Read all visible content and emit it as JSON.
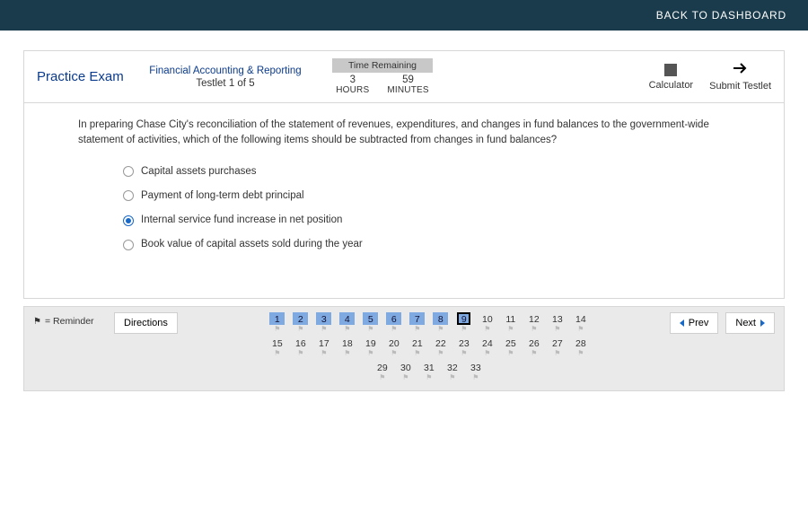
{
  "topbar": {
    "back_label": "BACK TO DASHBOARD"
  },
  "header": {
    "exam_title": "Practice Exam",
    "section_name": "Financial Accounting & Reporting",
    "testlet_text": "Testlet 1 of 5",
    "time_remaining_label": "Time Remaining",
    "hours_val": "3",
    "hours_label": "HOURS",
    "minutes_val": "59",
    "minutes_label": "MINUTES",
    "calculator_label": "Calculator",
    "submit_label": "Submit Testlet"
  },
  "question": {
    "text": "In preparing Chase City's reconciliation of the statement of revenues, expenditures, and changes in fund balances to the government-wide statement of activities, which of the following items should be subtracted from changes in fund balances?",
    "options": [
      {
        "label": "Capital assets purchases",
        "selected": false
      },
      {
        "label": "Payment of long-term debt principal",
        "selected": false
      },
      {
        "label": "Internal service fund increase in net position",
        "selected": true
      },
      {
        "label": "Book value of capital assets sold during the year",
        "selected": false
      }
    ]
  },
  "navigator": {
    "reminder_text": "= Reminder",
    "directions_label": "Directions",
    "prev_label": "Prev",
    "next_label": "Next",
    "questions": [
      {
        "n": "1",
        "answered": true,
        "current": false
      },
      {
        "n": "2",
        "answered": true,
        "current": false
      },
      {
        "n": "3",
        "answered": true,
        "current": false
      },
      {
        "n": "4",
        "answered": true,
        "current": false
      },
      {
        "n": "5",
        "answered": true,
        "current": false
      },
      {
        "n": "6",
        "answered": true,
        "current": false
      },
      {
        "n": "7",
        "answered": true,
        "current": false
      },
      {
        "n": "8",
        "answered": true,
        "current": false
      },
      {
        "n": "9",
        "answered": true,
        "current": true
      },
      {
        "n": "10",
        "answered": false,
        "current": false
      },
      {
        "n": "11",
        "answered": false,
        "current": false
      },
      {
        "n": "12",
        "answered": false,
        "current": false
      },
      {
        "n": "13",
        "answered": false,
        "current": false
      },
      {
        "n": "14",
        "answered": false,
        "current": false
      },
      {
        "n": "15",
        "answered": false,
        "current": false
      },
      {
        "n": "16",
        "answered": false,
        "current": false
      },
      {
        "n": "17",
        "answered": false,
        "current": false
      },
      {
        "n": "18",
        "answered": false,
        "current": false
      },
      {
        "n": "19",
        "answered": false,
        "current": false
      },
      {
        "n": "20",
        "answered": false,
        "current": false
      },
      {
        "n": "21",
        "answered": false,
        "current": false
      },
      {
        "n": "22",
        "answered": false,
        "current": false
      },
      {
        "n": "23",
        "answered": false,
        "current": false
      },
      {
        "n": "24",
        "answered": false,
        "current": false
      },
      {
        "n": "25",
        "answered": false,
        "current": false
      },
      {
        "n": "26",
        "answered": false,
        "current": false
      },
      {
        "n": "27",
        "answered": false,
        "current": false
      },
      {
        "n": "28",
        "answered": false,
        "current": false
      },
      {
        "n": "29",
        "answered": false,
        "current": false
      },
      {
        "n": "30",
        "answered": false,
        "current": false
      },
      {
        "n": "31",
        "answered": false,
        "current": false
      },
      {
        "n": "32",
        "answered": false,
        "current": false
      },
      {
        "n": "33",
        "answered": false,
        "current": false
      }
    ]
  }
}
